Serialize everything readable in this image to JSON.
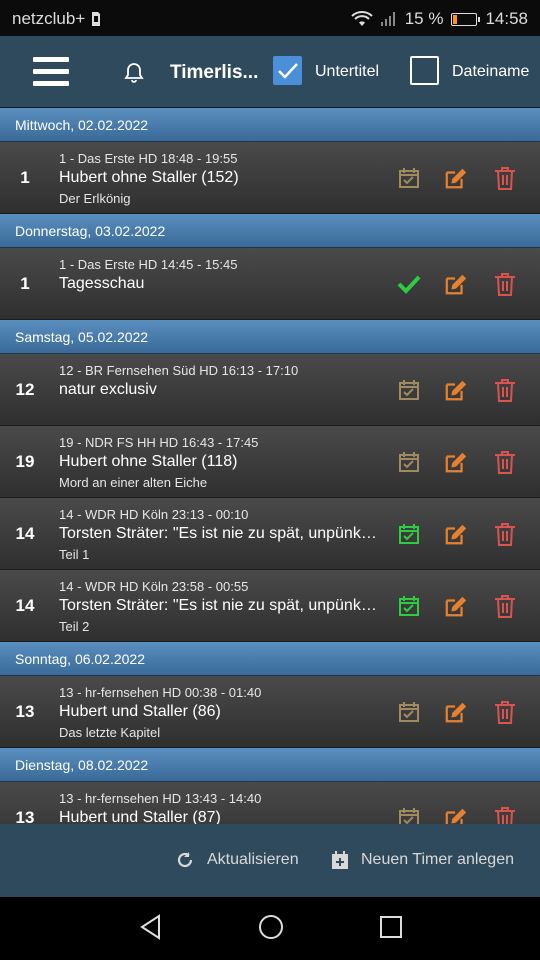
{
  "status_bar": {
    "carrier": "netzclub+",
    "battery_percent": "15 %",
    "time": "14:58"
  },
  "app_bar": {
    "title": "Timerlis...",
    "checkbox_untertitel": {
      "label": "Untertitel",
      "checked": true
    },
    "checkbox_dateiname": {
      "label": "Dateiname",
      "checked": false
    }
  },
  "groups": [
    {
      "date": "Mittwoch, 02.02.2022",
      "rows": [
        {
          "ch": "1",
          "meta": "1 - Das Erste HD  18:48 - 19:55",
          "title": "Hubert ohne Staller (152)",
          "sub": "Der Erlkönig",
          "status": "scheduled"
        }
      ]
    },
    {
      "date": "Donnerstag, 03.02.2022",
      "rows": [
        {
          "ch": "1",
          "meta": "1 - Das Erste HD  14:45 - 15:45",
          "title": "Tagesschau",
          "sub": "",
          "status": "done"
        }
      ]
    },
    {
      "date": "Samstag, 05.02.2022",
      "rows": [
        {
          "ch": "12",
          "meta": "12 - BR Fernsehen Süd HD  16:13 - 17:10",
          "title": "natur exclusiv",
          "sub": "",
          "status": "scheduled"
        },
        {
          "ch": "19",
          "meta": "19 - NDR FS HH HD  16:43 - 17:45",
          "title": "Hubert ohne Staller (118)",
          "sub": "Mord an einer alten Eiche",
          "status": "scheduled"
        },
        {
          "ch": "14",
          "meta": "14 - WDR HD Köln  23:13 - 00:10",
          "title": "Torsten Sträter: \"Es ist nie zu spät, unpünktlich zu sein\"",
          "sub": "Teil 1",
          "status": "active"
        },
        {
          "ch": "14",
          "meta": "14 - WDR HD Köln  23:58 - 00:55",
          "title": "Torsten Sträter: \"Es ist nie zu spät, unpünktlich zu sein\"",
          "sub": "Teil 2",
          "status": "active"
        }
      ]
    },
    {
      "date": "Sonntag, 06.02.2022",
      "rows": [
        {
          "ch": "13",
          "meta": "13 - hr-fernsehen HD  00:38 - 01:40",
          "title": "Hubert und Staller (86)",
          "sub": "Das letzte Kapitel",
          "status": "scheduled"
        }
      ]
    },
    {
      "date": "Dienstag, 08.02.2022",
      "rows": [
        {
          "ch": "13",
          "meta": "13 - hr-fernsehen HD  13:43 - 14:40",
          "title": "Hubert und Staller (87)",
          "sub": "",
          "status": "scheduled"
        }
      ]
    }
  ],
  "bottom_bar": {
    "refresh_label": "Aktualisieren",
    "new_timer_label": "Neuen Timer anlegen"
  },
  "colors": {
    "edit": "#e8812f",
    "delete": "#d9534f",
    "active": "#2ecc40",
    "scheduled": "#a08a5f",
    "appbar": "#2f4a5d"
  },
  "icons": {
    "status_scheduled": "calendar-check-icon",
    "status_active": "calendar-check-icon",
    "status_done": "checkmark-icon",
    "edit": "edit-icon",
    "delete": "trash-icon"
  }
}
